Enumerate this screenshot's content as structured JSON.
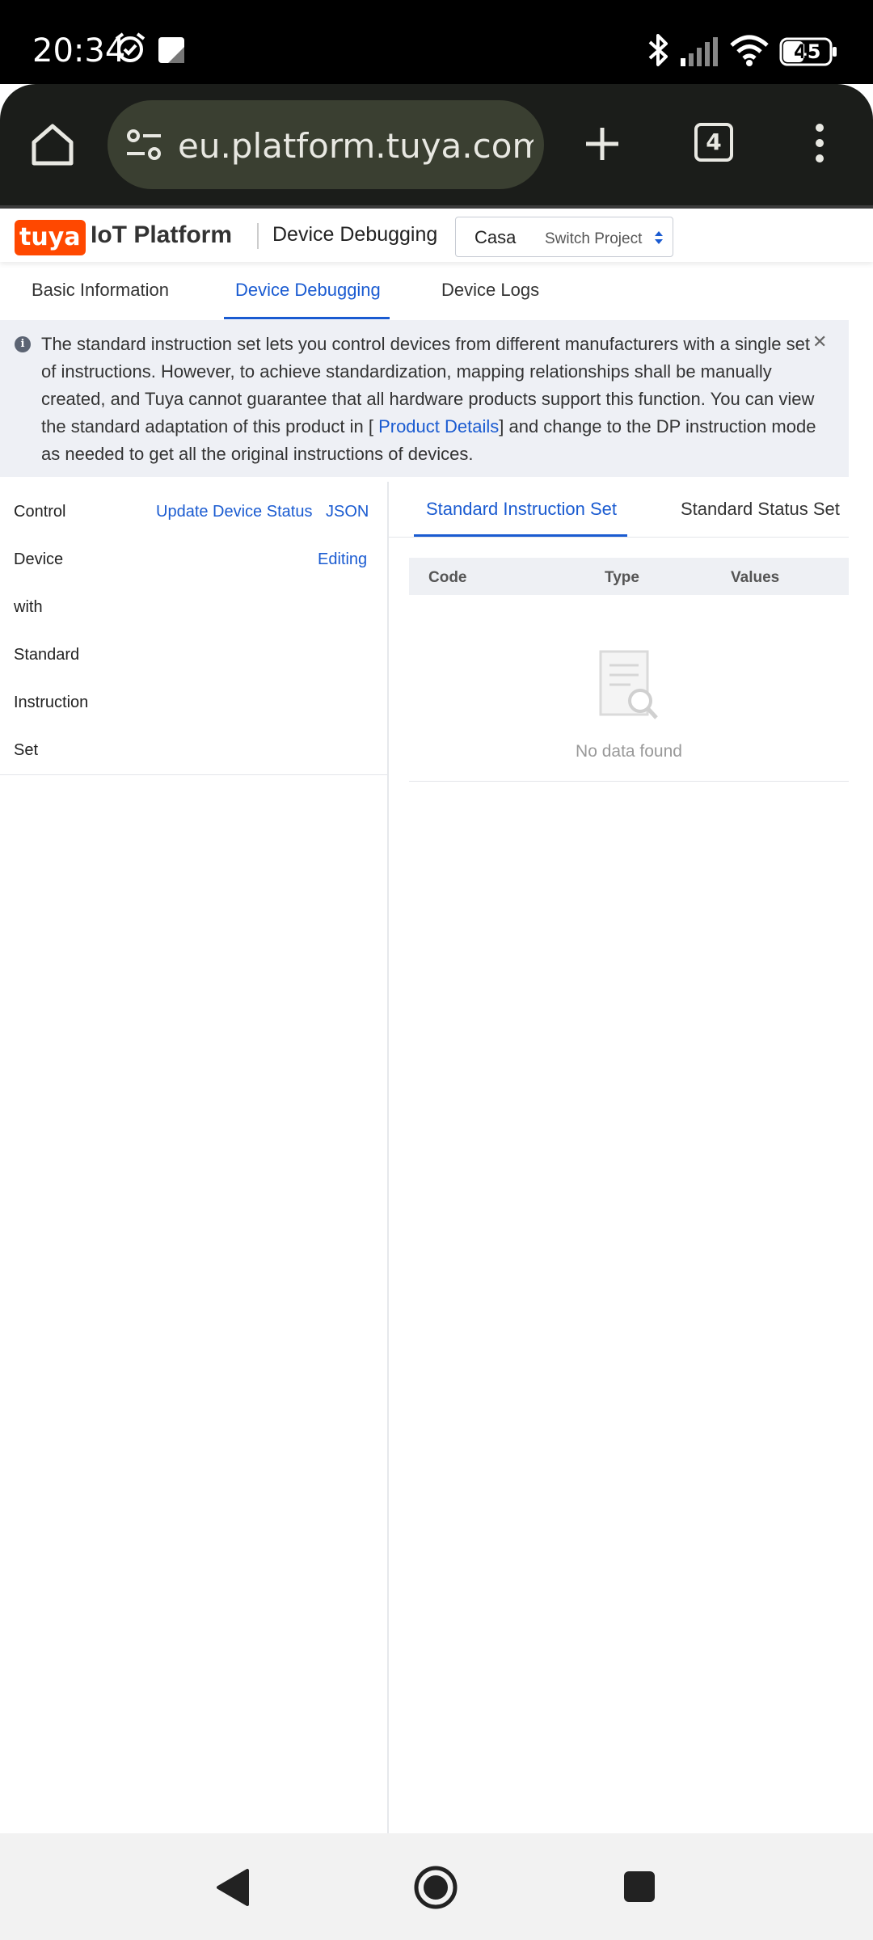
{
  "status_bar": {
    "time": "20:34",
    "battery": "45",
    "icons": [
      "alarm-icon",
      "notification-icon",
      "bluetooth-icon",
      "signal-icon",
      "wifi-icon",
      "battery-icon"
    ]
  },
  "browser": {
    "url": "eu.platform.tuya.com/",
    "tab_count": "4",
    "icons": [
      "home-icon",
      "site-settings-icon",
      "new-tab-icon",
      "tab-switcher-icon",
      "menu-icon"
    ]
  },
  "app_header": {
    "logo": "tuya",
    "platform": "IoT Platform",
    "title": "Device Debugging",
    "project_name": "Casa",
    "switch_label": "Switch Project"
  },
  "tabs": [
    {
      "label": "Basic Information",
      "active": false
    },
    {
      "label": "Device Debugging",
      "active": true
    },
    {
      "label": "Device Logs",
      "active": false
    }
  ],
  "alert": {
    "text_before": "The standard instruction set lets you control devices from different manufacturers with a single set of instructions. However, to achieve standardization, mapping relationships shall be manually created, and Tuya cannot guarantee that all hardware products support this function. You can view the standard adaptation of this product in [ ",
    "link": "Product Details",
    "text_after": "] and change to the DP instruction mode as needed to get all the original instructions of devices."
  },
  "left_panel": {
    "title_words": [
      "Control",
      "Device",
      "with",
      "Standard",
      "Instruction",
      "Set"
    ],
    "update_status": "Update Device Status",
    "json": "JSON",
    "editing": "Editing"
  },
  "right_panel": {
    "tabs": [
      {
        "label": "Standard Instruction Set",
        "active": true
      },
      {
        "label": "Standard Status Set",
        "active": false
      }
    ],
    "columns": [
      "Code",
      "Type",
      "Values"
    ],
    "empty_text": "No data found"
  },
  "colors": {
    "accent": "#1a5bd1",
    "brand": "#ff4800",
    "alert_bg": "#eef0f5"
  }
}
